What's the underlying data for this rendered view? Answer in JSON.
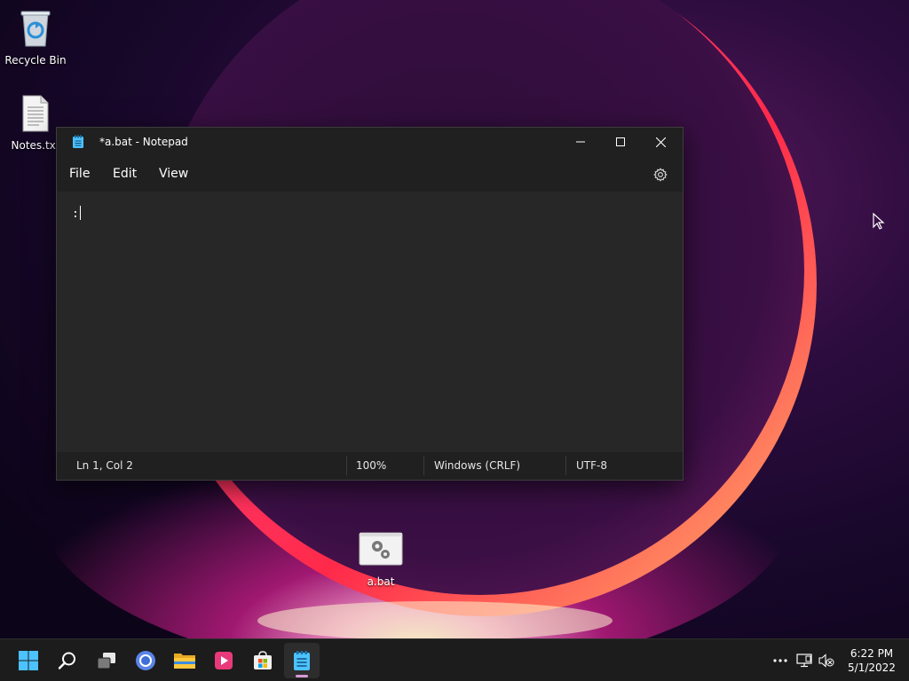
{
  "desktop": {
    "icons": [
      {
        "label": "Recycle Bin",
        "icon": "recycle-bin-icon"
      },
      {
        "label": "Notes.txt",
        "icon": "text-file-icon"
      },
      {
        "label": "a.bat",
        "icon": "batch-file-icon"
      }
    ]
  },
  "notepad": {
    "title": "*a.bat - Notepad",
    "menu": [
      "File",
      "Edit",
      "View"
    ],
    "content": ":",
    "status": {
      "position": "Ln 1, Col 2",
      "zoom": "100%",
      "line_ending": "Windows (CRLF)",
      "encoding": "UTF-8"
    }
  },
  "taskbar": {
    "apps": [
      "start-icon",
      "search-icon",
      "task-view-icon",
      "chrome-icon",
      "file-explorer-icon",
      "media-player-icon",
      "microsoft-store-icon",
      "notepad-icon"
    ],
    "tray": [
      "overflow-icon",
      "network-icon",
      "volume-muted-icon"
    ],
    "time": "6:22 PM",
    "date": "5/1/2022"
  },
  "colors": {
    "accent": "#4cc2ff",
    "window_bg": "#272727",
    "chrome_bg": "#202020",
    "taskbar_bg": "#1c1c1c"
  }
}
